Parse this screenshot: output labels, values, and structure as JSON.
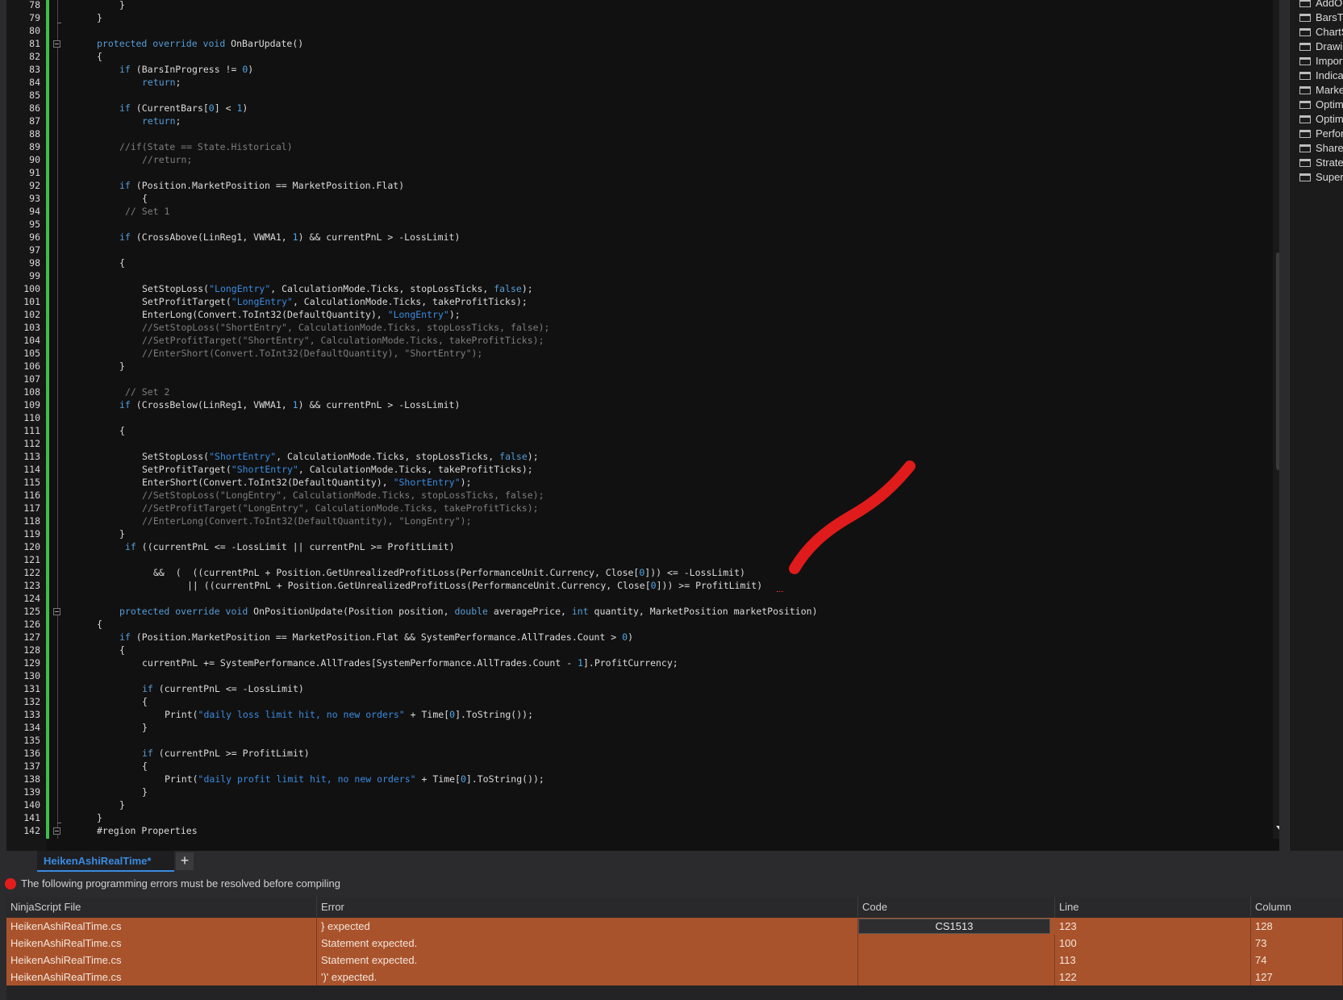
{
  "editor": {
    "lines": [
      {
        "n": 78,
        "code": [
          [
            "}",
            ""
          ]
        ],
        "indent": 10
      },
      {
        "n": 79,
        "code": [
          [
            "}",
            ""
          ]
        ],
        "indent": 6
      },
      {
        "n": 80,
        "code": [],
        "indent": 0
      },
      {
        "n": 81,
        "code": [
          [
            "protected override void",
            "kw"
          ],
          [
            " OnBarUpdate()",
            ""
          ]
        ],
        "indent": 6
      },
      {
        "n": 82,
        "code": [
          [
            "{",
            ""
          ]
        ],
        "indent": 6
      },
      {
        "n": 83,
        "code": [
          [
            "if",
            "kw"
          ],
          [
            " (BarsInProgress != ",
            ""
          ],
          [
            "0",
            "num"
          ],
          [
            ")",
            ""
          ]
        ],
        "indent": 10
      },
      {
        "n": 84,
        "code": [
          [
            "return",
            "kw"
          ],
          [
            ";",
            ""
          ]
        ],
        "indent": 14
      },
      {
        "n": 85,
        "code": [],
        "indent": 0
      },
      {
        "n": 86,
        "code": [
          [
            "if",
            "kw"
          ],
          [
            " (CurrentBars[",
            ""
          ],
          [
            "0",
            "num"
          ],
          [
            "] < ",
            ""
          ],
          [
            "1",
            "num"
          ],
          [
            ")",
            ""
          ]
        ],
        "indent": 10
      },
      {
        "n": 87,
        "code": [
          [
            "return",
            "kw"
          ],
          [
            ";",
            ""
          ]
        ],
        "indent": 14
      },
      {
        "n": 88,
        "code": [],
        "indent": 0
      },
      {
        "n": 89,
        "code": [
          [
            "//if(State == State.Historical)",
            "cm"
          ]
        ],
        "indent": 10
      },
      {
        "n": 90,
        "code": [
          [
            "//return;",
            "cm"
          ]
        ],
        "indent": 14
      },
      {
        "n": 91,
        "code": [],
        "indent": 0
      },
      {
        "n": 92,
        "code": [
          [
            "if",
            "kw"
          ],
          [
            " (Position.MarketPosition == MarketPosition.Flat)",
            ""
          ]
        ],
        "indent": 10
      },
      {
        "n": 93,
        "code": [
          [
            "{",
            ""
          ]
        ],
        "indent": 14
      },
      {
        "n": 94,
        "code": [
          [
            "// Set 1",
            "cm"
          ]
        ],
        "indent": 11
      },
      {
        "n": 95,
        "code": [],
        "indent": 0
      },
      {
        "n": 96,
        "code": [
          [
            "if",
            "kw"
          ],
          [
            " (CrossAbove(LinReg1, VWMA1, ",
            ""
          ],
          [
            "1",
            "num"
          ],
          [
            ") && currentPnL > -LossLimit)",
            ""
          ]
        ],
        "indent": 10
      },
      {
        "n": 97,
        "code": [],
        "indent": 0
      },
      {
        "n": 98,
        "code": [
          [
            "{",
            ""
          ]
        ],
        "indent": 10
      },
      {
        "n": 99,
        "code": [],
        "indent": 0
      },
      {
        "n": 100,
        "code": [
          [
            "SetStopLoss(",
            ""
          ],
          [
            "\"LongEntry\"",
            "str"
          ],
          [
            ", CalculationMode.Ticks, stopLossTicks, ",
            ""
          ],
          [
            "false",
            "kw"
          ],
          [
            ");",
            ""
          ]
        ],
        "indent": 14
      },
      {
        "n": 101,
        "code": [
          [
            "SetProfitTarget(",
            ""
          ],
          [
            "\"LongEntry\"",
            "str"
          ],
          [
            ", CalculationMode.Ticks, takeProfitTicks);",
            ""
          ]
        ],
        "indent": 14
      },
      {
        "n": 102,
        "code": [
          [
            "EnterLong(Convert.ToInt32(DefaultQuantity), ",
            ""
          ],
          [
            "\"LongEntry\"",
            "str"
          ],
          [
            ");",
            ""
          ]
        ],
        "indent": 14
      },
      {
        "n": 103,
        "code": [
          [
            "//SetStopLoss(\"ShortEntry\", CalculationMode.Ticks, stopLossTicks, false);",
            "cm"
          ]
        ],
        "indent": 14
      },
      {
        "n": 104,
        "code": [
          [
            "//SetProfitTarget(\"ShortEntry\", CalculationMode.Ticks, takeProfitTicks);",
            "cm"
          ]
        ],
        "indent": 14
      },
      {
        "n": 105,
        "code": [
          [
            "//EnterShort(Convert.ToInt32(DefaultQuantity), \"ShortEntry\");",
            "cm"
          ]
        ],
        "indent": 14
      },
      {
        "n": 106,
        "code": [
          [
            "}",
            ""
          ]
        ],
        "indent": 10
      },
      {
        "n": 107,
        "code": [],
        "indent": 0
      },
      {
        "n": 108,
        "code": [
          [
            "// Set 2",
            "cm"
          ]
        ],
        "indent": 11
      },
      {
        "n": 109,
        "code": [
          [
            "if",
            "kw"
          ],
          [
            " (CrossBelow(LinReg1, VWMA1, ",
            ""
          ],
          [
            "1",
            "num"
          ],
          [
            ") && currentPnL > -LossLimit)",
            ""
          ]
        ],
        "indent": 10
      },
      {
        "n": 110,
        "code": [],
        "indent": 0
      },
      {
        "n": 111,
        "code": [
          [
            "{",
            ""
          ]
        ],
        "indent": 10
      },
      {
        "n": 112,
        "code": [],
        "indent": 0
      },
      {
        "n": 113,
        "code": [
          [
            "SetStopLoss(",
            ""
          ],
          [
            "\"ShortEntry\"",
            "str"
          ],
          [
            ", CalculationMode.Ticks, stopLossTicks, ",
            ""
          ],
          [
            "false",
            "kw"
          ],
          [
            ");",
            ""
          ]
        ],
        "indent": 14
      },
      {
        "n": 114,
        "code": [
          [
            "SetProfitTarget(",
            ""
          ],
          [
            "\"ShortEntry\"",
            "str"
          ],
          [
            ", CalculationMode.Ticks, takeProfitTicks);",
            ""
          ]
        ],
        "indent": 14
      },
      {
        "n": 115,
        "code": [
          [
            "EnterShort(Convert.ToInt32(DefaultQuantity), ",
            ""
          ],
          [
            "\"ShortEntry\"",
            "str"
          ],
          [
            ");",
            ""
          ]
        ],
        "indent": 14
      },
      {
        "n": 116,
        "code": [
          [
            "//SetStopLoss(\"LongEntry\", CalculationMode.Ticks, stopLossTicks, false);",
            "cm"
          ]
        ],
        "indent": 14
      },
      {
        "n": 117,
        "code": [
          [
            "//SetProfitTarget(\"LongEntry\", CalculationMode.Ticks, takeProfitTicks);",
            "cm"
          ]
        ],
        "indent": 14
      },
      {
        "n": 118,
        "code": [
          [
            "//EnterLong(Convert.ToInt32(DefaultQuantity), \"LongEntry\");",
            "cm"
          ]
        ],
        "indent": 14
      },
      {
        "n": 119,
        "code": [
          [
            "}",
            ""
          ]
        ],
        "indent": 10
      },
      {
        "n": 120,
        "code": [
          [
            "if",
            "kw"
          ],
          [
            " ((currentPnL <= -LossLimit || currentPnL >= ProfitLimit)",
            ""
          ]
        ],
        "indent": 11
      },
      {
        "n": 121,
        "code": [],
        "indent": 0
      },
      {
        "n": 122,
        "code": [
          [
            "&&  (  ((currentPnL + Position.GetUnrealizedProfitLoss(PerformanceUnit.Currency, Close[",
            ""
          ],
          [
            "0",
            "num"
          ],
          [
            "])) <= -LossLimit)",
            ""
          ]
        ],
        "indent": 16
      },
      {
        "n": 123,
        "code": [
          [
            "|| ((currentPnL + Position.GetUnrealizedProfitLoss(PerformanceUnit.Currency, Close[",
            ""
          ],
          [
            "0",
            "num"
          ],
          [
            "])) >= ProfitLimit)",
            ""
          ]
        ],
        "indent": 22
      },
      {
        "n": 124,
        "code": [],
        "indent": 0
      },
      {
        "n": 125,
        "code": [
          [
            "protected override void",
            "kw"
          ],
          [
            " OnPositionUpdate(Position position, ",
            ""
          ],
          [
            "double",
            "kw"
          ],
          [
            " averagePrice, ",
            ""
          ],
          [
            "int",
            "kw"
          ],
          [
            " quantity, MarketPosition marketPosition)",
            ""
          ]
        ],
        "indent": 10
      },
      {
        "n": 126,
        "code": [
          [
            "{",
            ""
          ]
        ],
        "indent": 6
      },
      {
        "n": 127,
        "code": [
          [
            "if",
            "kw"
          ],
          [
            " (Position.MarketPosition == MarketPosition.Flat && SystemPerformance.AllTrades.Count > ",
            ""
          ],
          [
            "0",
            "num"
          ],
          [
            ")",
            ""
          ]
        ],
        "indent": 10
      },
      {
        "n": 128,
        "code": [
          [
            "{",
            ""
          ]
        ],
        "indent": 10
      },
      {
        "n": 129,
        "code": [
          [
            "currentPnL += SystemPerformance.AllTrades[SystemPerformance.AllTrades.Count - ",
            ""
          ],
          [
            "1",
            "num"
          ],
          [
            "].ProfitCurrency;",
            ""
          ]
        ],
        "indent": 14
      },
      {
        "n": 130,
        "code": [],
        "indent": 0
      },
      {
        "n": 131,
        "code": [
          [
            "if",
            "kw"
          ],
          [
            " (currentPnL <= -LossLimit)",
            ""
          ]
        ],
        "indent": 14
      },
      {
        "n": 132,
        "code": [
          [
            "{",
            ""
          ]
        ],
        "indent": 14
      },
      {
        "n": 133,
        "code": [
          [
            "Print(",
            ""
          ],
          [
            "\"daily loss limit hit, no new orders\"",
            "str"
          ],
          [
            " + Time[",
            ""
          ],
          [
            "0",
            "num"
          ],
          [
            "].ToString());",
            ""
          ]
        ],
        "indent": 18
      },
      {
        "n": 134,
        "code": [
          [
            "}",
            ""
          ]
        ],
        "indent": 14
      },
      {
        "n": 135,
        "code": [],
        "indent": 0
      },
      {
        "n": 136,
        "code": [
          [
            "if",
            "kw"
          ],
          [
            " (currentPnL >= ProfitLimit)",
            ""
          ]
        ],
        "indent": 14
      },
      {
        "n": 137,
        "code": [
          [
            "{",
            ""
          ]
        ],
        "indent": 14
      },
      {
        "n": 138,
        "code": [
          [
            "Print(",
            ""
          ],
          [
            "\"daily profit limit hit, no new orders\"",
            "str"
          ],
          [
            " + Time[",
            ""
          ],
          [
            "0",
            "num"
          ],
          [
            "].ToString());",
            ""
          ]
        ],
        "indent": 18
      },
      {
        "n": 139,
        "code": [
          [
            "}",
            ""
          ]
        ],
        "indent": 14
      },
      {
        "n": 140,
        "code": [
          [
            "}",
            ""
          ]
        ],
        "indent": 10
      },
      {
        "n": 141,
        "code": [
          [
            "}",
            ""
          ]
        ],
        "indent": 6
      },
      {
        "n": 142,
        "code": [
          [
            "#region Properties",
            ""
          ]
        ],
        "indent": 6
      }
    ]
  },
  "explorer": {
    "folders": [
      "AddOns",
      "BarsTypes",
      "ChartStyles",
      "DrawingTools",
      "ImportTypes",
      "Indicators",
      "MarketAnalyzerColumns",
      "OptimizationFitnesses",
      "Optimizers",
      "PerformanceMetrics",
      "ShareServices",
      "Strategies",
      "SuperDomColumns"
    ]
  },
  "tabs": {
    "active_label": "HeikenAshiRealTime*",
    "add_label": "+"
  },
  "errors": {
    "message": "The following programming errors must be resolved before compiling",
    "headers": {
      "file": "NinjaScript File",
      "error": "Error",
      "code": "Code",
      "line": "Line",
      "column": "Column"
    },
    "rows": [
      {
        "file": "HeikenAshiRealTime.cs",
        "error": "} expected",
        "code": "CS1513",
        "line": "123",
        "column": "128"
      },
      {
        "file": "HeikenAshiRealTime.cs",
        "error": "Statement expected.",
        "code": "",
        "line": "100",
        "column": "73"
      },
      {
        "file": "HeikenAshiRealTime.cs",
        "error": "Statement expected.",
        "code": "",
        "line": "113",
        "column": "74"
      },
      {
        "file": "HeikenAshiRealTime.cs",
        "error": "')' expected.",
        "code": "",
        "line": "122",
        "column": "127"
      }
    ]
  },
  "colors": {
    "error_row": "#a9532c",
    "keyword": "#569cd6",
    "string": "#3b8be0",
    "comment": "#7e7e7e",
    "change_bar": "#3fbf4a",
    "annotation": "#e01b1b"
  }
}
